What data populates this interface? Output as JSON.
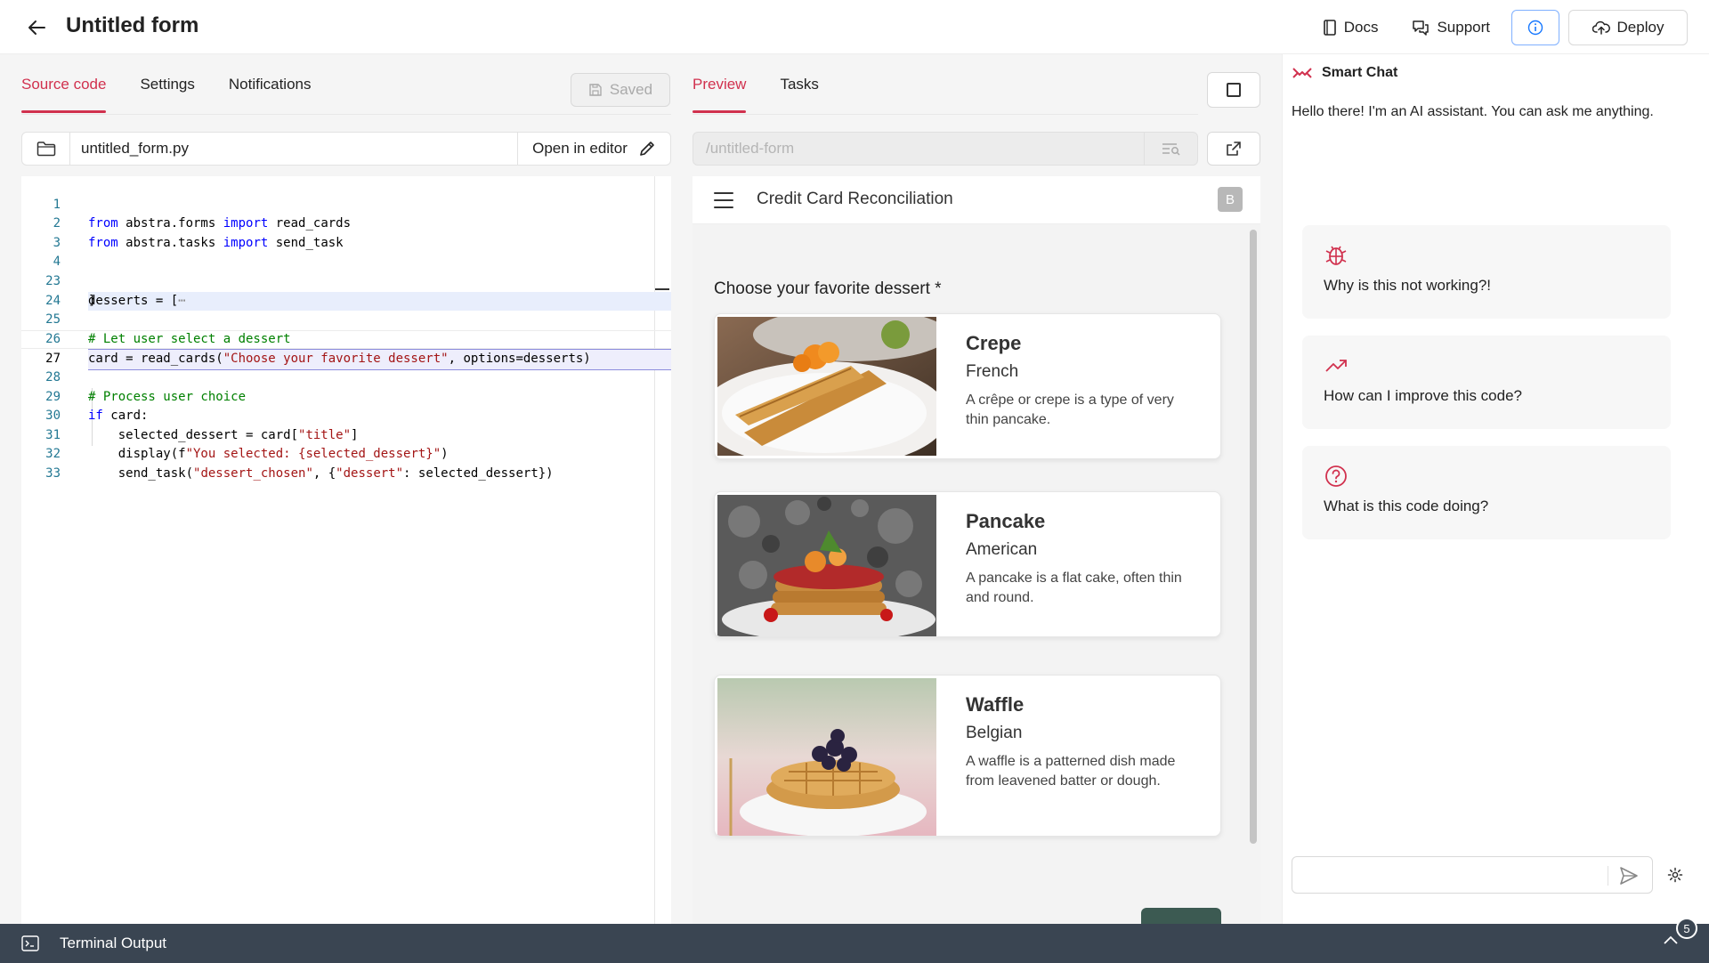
{
  "header": {
    "title": "Untitled form",
    "docs": "Docs",
    "support": "Support",
    "deploy": "Deploy"
  },
  "left_tabs": [
    "Source code",
    "Settings",
    "Notifications"
  ],
  "saved_label": "Saved",
  "file": {
    "name": "untitled_form.py",
    "open_label": "Open in editor"
  },
  "code": {
    "line_numbers": [
      "1",
      "2",
      "3",
      "4",
      "23",
      "24",
      "25",
      "26",
      "27",
      "28",
      "29",
      "30",
      "31",
      "32",
      "33"
    ],
    "l1": {
      "kw1": "from",
      "a": " abstra.forms ",
      "kw2": "import",
      "b": " read_cards"
    },
    "l2": {
      "kw1": "from",
      "a": " abstra.tasks ",
      "kw2": "import",
      "b": " send_task"
    },
    "l4": "desserts = [",
    "l4_fold": "⋯",
    "l23": "]",
    "l25": "# Let user select a dessert",
    "l26": {
      "a": "card = read_cards(",
      "s": "\"Choose your favorite dessert\"",
      "b": ", options=desserts)"
    },
    "l28": "# Process user choice",
    "l29": {
      "kw": "if",
      "a": " card:"
    },
    "l30": {
      "a": "    selected_dessert = card[",
      "s": "\"title\"",
      "b": "]"
    },
    "l31": {
      "a": "    display(f",
      "s": "\"You selected: {selected_dessert}\"",
      "b": ")"
    },
    "l32": {
      "a": "    send_task(",
      "s1": "\"dessert_chosen\"",
      "b": ", {",
      "s2": "\"dessert\"",
      "c": ": selected_dessert})"
    }
  },
  "mid_tabs": [
    "Preview",
    "Tasks"
  ],
  "url_placeholder": "/untitled-form",
  "preview": {
    "title": "Credit Card Reconciliation",
    "avatar": "B",
    "question": "Choose your favorite dessert *",
    "cards": [
      {
        "title": "Crepe",
        "origin": "French",
        "desc": "A crêpe or crepe is a type of very thin pancake."
      },
      {
        "title": "Pancake",
        "origin": "American",
        "desc": "A pancake is a flat cake, often thin and round."
      },
      {
        "title": "Waffle",
        "origin": "Belgian",
        "desc": "A waffle is a patterned dish made from leavened batter or dough."
      }
    ]
  },
  "chat": {
    "title": "Smart Chat",
    "message": "Hello there! I'm an AI assistant. You can ask me anything.",
    "suggestions": [
      "Why is this not working?!",
      "How can I improve this code?",
      "What is this code doing?"
    ],
    "accent": "#d1314e"
  },
  "terminal": {
    "label": "Terminal Output",
    "badge": "5"
  }
}
